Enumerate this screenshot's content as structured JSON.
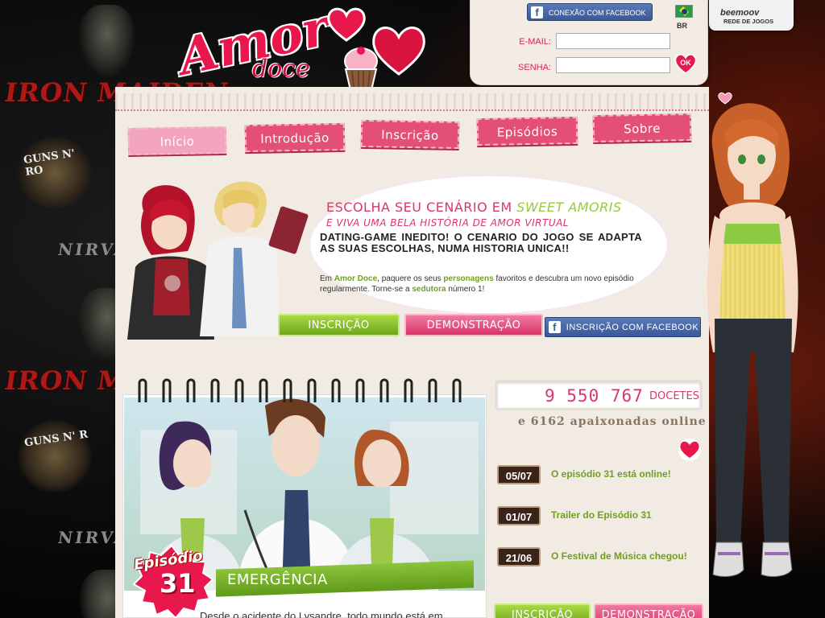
{
  "background": {
    "band_names": [
      "IRON MAIDEN",
      "GUNS N' RO",
      "NIRVA",
      "IRON MA",
      "GUNS N' R",
      "NIRVA"
    ]
  },
  "logo": {
    "word1": "Amor",
    "word2": "doce"
  },
  "login": {
    "facebook_button": "CONEXÃO COM FACEBOOK",
    "language": "BR",
    "email_label": "E-MAIL:",
    "email_value": "",
    "password_label": "SENHA:",
    "password_value": "",
    "ok_label": "OK"
  },
  "beemoov": {
    "logo": "beemoov",
    "subtitle": "REDE DE JOGOS"
  },
  "nav": {
    "tabs": [
      {
        "label": "Início",
        "active": true
      },
      {
        "label": "Introdução",
        "active": false
      },
      {
        "label": "Inscrição",
        "active": false
      },
      {
        "label": "Episódios",
        "active": false
      },
      {
        "label": "Sobre",
        "active": false
      }
    ]
  },
  "hero": {
    "title_prefix": "ESCOLHA SEU CENÁRIO EM ",
    "title_highlight": "SWEET AMORIS",
    "subtitle": "E VIVA UMA BELA HISTÓRIA DE AMOR VIRTUAL",
    "bold_text": "DATING-GAME INEDITO! O CENARIO DO JOGO SE ADAPTA AS SUAS ESCOLHAS, NUMA HISTORIA UNICA!!",
    "desc_1": "Em ",
    "desc_brand": "Amor Doce",
    "desc_2": ", paquere os seus ",
    "desc_chars": "personagens",
    "desc_3": " favoritos e descubra um novo episódio regularmente. Torne-se a ",
    "desc_seductress": "sedutora",
    "desc_4": " número 1!",
    "btn_signup": "INSCRIÇÃO",
    "btn_demo": "DEMONSTRAÇÃO",
    "btn_fb_signup": "INSCRIÇÃO COM FACEBOOK"
  },
  "episode": {
    "label": "Episódio",
    "number": "31",
    "title": "EMERGÊNCIA",
    "text_excerpt": "Desde o acidente do Lysandre, todo mundo está em"
  },
  "stats": {
    "count": "9 550 767",
    "unit": "DOCETES",
    "online": "e 6162 apaixonadas online"
  },
  "news": [
    {
      "date": "05/07",
      "text": "O episódio 31 está online!"
    },
    {
      "date": "01/07",
      "text": "Trailer do Episódio 31"
    },
    {
      "date": "21/06",
      "text": "O Festival de Música chegou!"
    }
  ],
  "bottom_buttons": {
    "signup": "INSCRIÇÃO",
    "demo": "DEMONSTRAÇÃO"
  },
  "colors": {
    "brand_pink": "#e44f78",
    "accent_green": "#9bc93b",
    "facebook_blue": "#3b5998",
    "panel_bg": "#f2ebe4"
  }
}
